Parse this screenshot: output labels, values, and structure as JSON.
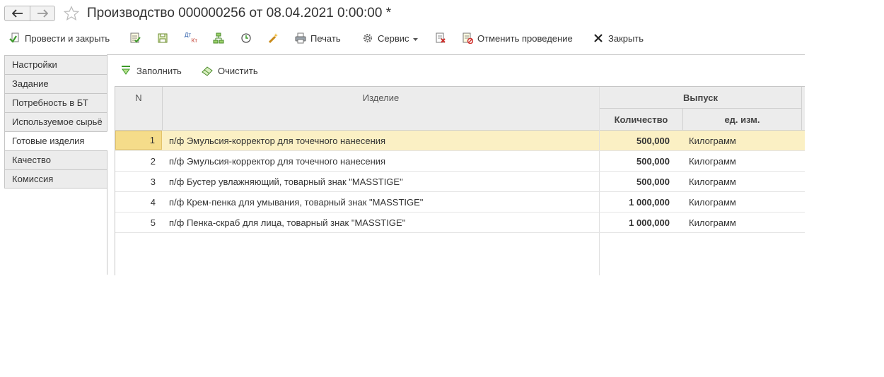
{
  "window": {
    "title": "Производство 000000256 от 08.04.2021 0:00:00 *"
  },
  "toolbar": {
    "post_and_close": "Провести и закрыть",
    "print": "Печать",
    "service": "Сервис",
    "cancel_posting": "Отменить проведение",
    "close": "Закрыть",
    "dt_kt_top": "Дт",
    "dt_kt_bottom": "Кт"
  },
  "sidebar": {
    "items": [
      {
        "label": "Настройки"
      },
      {
        "label": "Задание"
      },
      {
        "label": "Потребность в БТ"
      },
      {
        "label": "Используемое сырьё"
      },
      {
        "label": "Готовые изделия"
      },
      {
        "label": "Качество"
      },
      {
        "label": "Комиссия"
      }
    ],
    "active_index": 4
  },
  "panel": {
    "fill_label": "Заполнить",
    "clear_label": "Очистить"
  },
  "table": {
    "headers": {
      "n": "N",
      "item": "Изделие",
      "output": "Выпуск",
      "quantity": "Количество",
      "unit": "ед. изм."
    },
    "rows": [
      {
        "n": "1",
        "item": "п/ф Эмульсия-корректор для точечного нанесения",
        "quantity": "500,000",
        "unit": "Килограмм",
        "selected": true
      },
      {
        "n": "2",
        "item": "п/ф Эмульсия-корректор для точечного нанесения",
        "quantity": "500,000",
        "unit": "Килограмм",
        "selected": false
      },
      {
        "n": "3",
        "item": "п/ф Бустер увлажняющий, товарный знак \"MASSTIGE\"",
        "quantity": "500,000",
        "unit": "Килограмм",
        "selected": false
      },
      {
        "n": "4",
        "item": "п/ф Крем-пенка для умывания, товарный знак \"MASSTIGE\"",
        "quantity": "1 000,000",
        "unit": "Килограмм",
        "selected": false
      },
      {
        "n": "5",
        "item": "п/ф Пенка-скраб для лица, товарный знак \"MASSTIGE\"",
        "quantity": "1 000,000",
        "unit": "Килограмм",
        "selected": false
      }
    ]
  },
  "colors": {
    "selected_row": "#fbf0c4",
    "header_bg": "#ececec",
    "accent_green": "#4a9a2a"
  }
}
